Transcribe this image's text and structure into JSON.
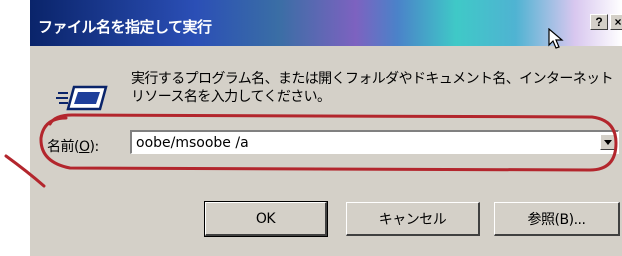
{
  "dialog": {
    "title": "ファイル名を指定して実行",
    "help_label": "?",
    "close_label": "×",
    "description": "実行するプログラム名、または開くフォルダやドキュメント名、インターネットリソース名を入力してください。",
    "name_label_prefix": "名前(",
    "name_label_mnemonic": "O",
    "name_label_suffix": "):",
    "command_value": "oobe/msoobe /a",
    "ok_label": "OK",
    "cancel_label": "キャンセル",
    "browse_label": "参照(B)..."
  },
  "icons": {
    "run": "run-dialog-icon",
    "dropdown": "chevron-down-icon",
    "cursor": "mouse-pointer-icon",
    "annotation": "red-highlight-ring"
  },
  "colors": {
    "face": "#d4d0c8",
    "title_start": "#0a246a",
    "title_text": "#ffffff",
    "annotation": "#b3262d"
  }
}
